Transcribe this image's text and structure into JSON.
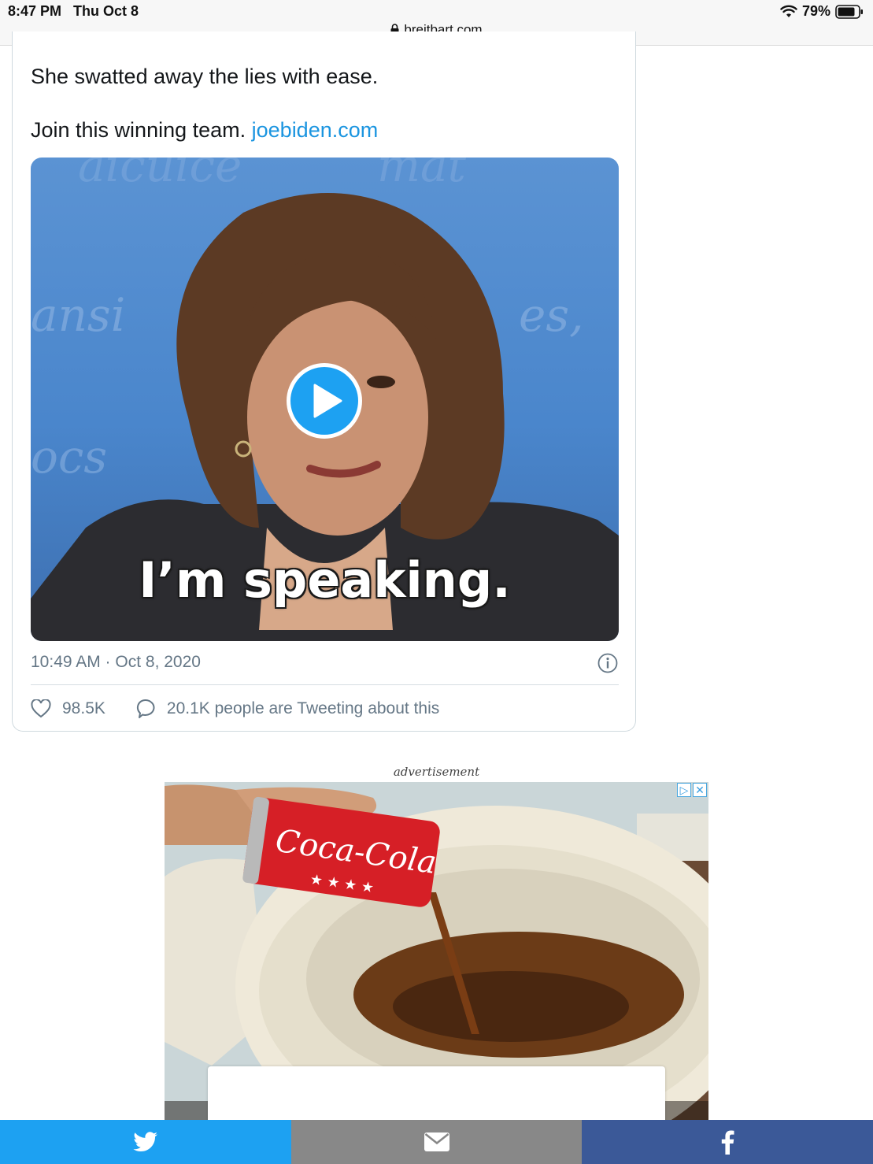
{
  "status_bar": {
    "time": "8:47 PM",
    "date": "Thu Oct 8",
    "battery": "79%",
    "url": "breitbart.com"
  },
  "tweet": {
    "line1": "She swatted away the lies with ease.",
    "line2_text": "Join this winning team. ",
    "line2_link": "joebiden.com",
    "media_caption": "I’m speaking.",
    "timestamp": "10:49 AM · Oct 8, 2020",
    "likes": "98.5K",
    "replies_text": "20.1K people are Tweeting about this"
  },
  "ad": {
    "label": "advertisement",
    "can_text": "Coca-Cola"
  },
  "share_bar": {
    "colors": {
      "twitter": "#1da1f2",
      "email": "#888888",
      "facebook": "#3b5998"
    },
    "icons": [
      "twitter-icon",
      "email-icon",
      "facebook-icon"
    ]
  }
}
